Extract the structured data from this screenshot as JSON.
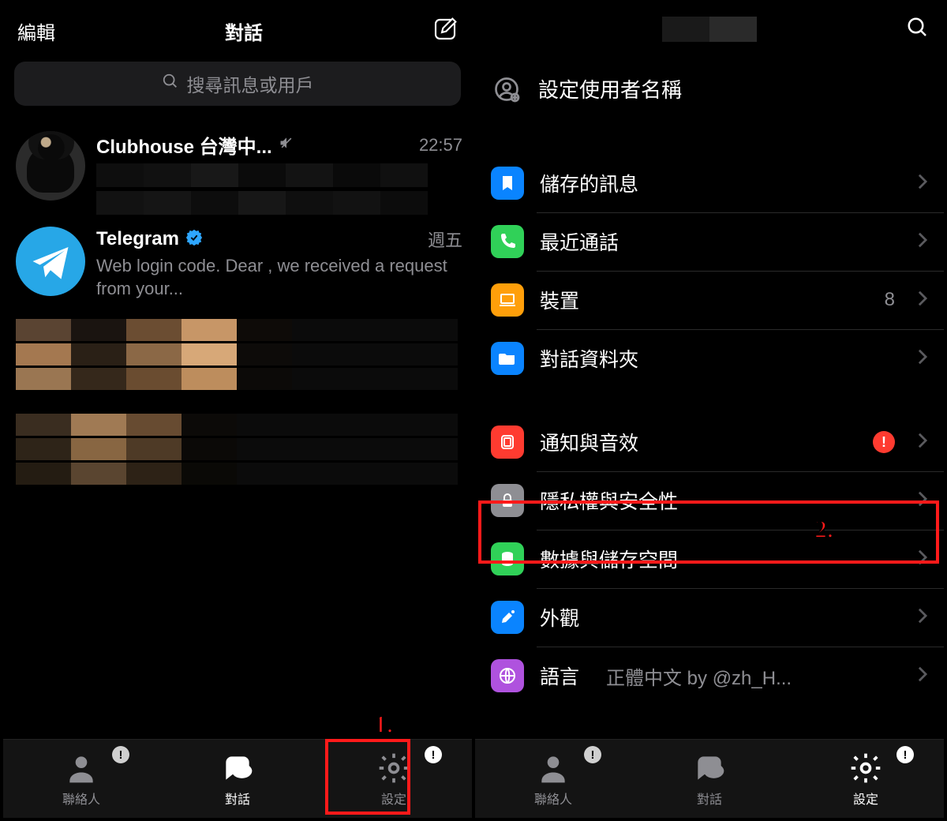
{
  "left": {
    "nav": {
      "edit": "編輯",
      "title": "對話"
    },
    "search_placeholder": "搜尋訊息或用戶",
    "chats": [
      {
        "name": "Clubhouse 台灣中...",
        "time": "22:57",
        "muted": true,
        "verified": false,
        "preview": ""
      },
      {
        "name": "Telegram",
        "time": "週五",
        "muted": false,
        "verified": true,
        "preview": "Web login code. Dear        , we received a request from your..."
      }
    ],
    "tabs": {
      "contacts": "聯絡人",
      "chats": "對話",
      "settings": "設定"
    },
    "annotation1": "1."
  },
  "right": {
    "set_username": "設定使用者名稱",
    "items": {
      "saved": "儲存的訊息",
      "calls": "最近通話",
      "devices": "裝置",
      "devices_value": "8",
      "folders": "對話資料夾",
      "notifications": "通知與音效",
      "privacy": "隱私權與安全性",
      "data": "數據與儲存空間",
      "appearance": "外觀",
      "language": "語言",
      "language_value": "正體中文 by @zh_H..."
    },
    "tabs": {
      "contacts": "聯絡人",
      "chats": "對話",
      "settings": "設定"
    },
    "annotation2": "2."
  }
}
